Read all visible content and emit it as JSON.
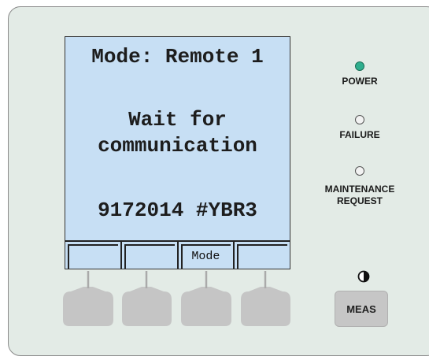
{
  "display": {
    "lines": [
      "Mode: Remote 1",
      "Wait for",
      "communication",
      "9172014 #YBR3"
    ],
    "softkeys": [
      "",
      "",
      "Mode",
      ""
    ]
  },
  "indicators": {
    "power": {
      "label": "POWER",
      "state": "on",
      "color": "#2fae8e"
    },
    "failure": {
      "label": "FAILURE",
      "state": "off"
    },
    "maintenance": {
      "label": "MAINTENANCE\nREQUEST",
      "state": "off"
    }
  },
  "controls": {
    "contrast_icon": "contrast-icon",
    "meas_label": "MEAS"
  }
}
